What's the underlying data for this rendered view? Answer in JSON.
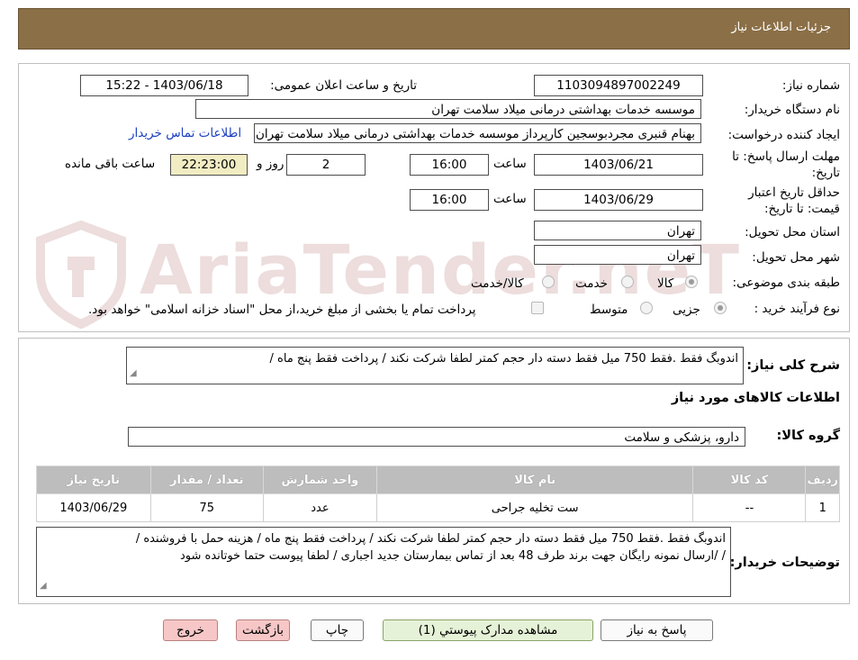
{
  "header": {
    "title": "جزئیات اطلاعات نیاز"
  },
  "info": {
    "need_number_label": "شماره نیاز:",
    "need_number": "1103094897002249",
    "announce_label": "تاریخ و ساعت اعلان عمومی:",
    "announce_value": "1403/06/18 - 15:22",
    "buyer_org_label": "نام دستگاه خریدار:",
    "buyer_org": "موسسه خدمات بهداشتی درمانی میلاد سلامت تهران",
    "creator_label": "ایجاد کننده درخواست:",
    "creator": "بهنام قنبری مجردبوسجین کارپرداز موسسه خدمات بهداشتی درمانی میلاد سلامت تهران",
    "contact_link": "اطلاعات تماس خریدار",
    "deadline_label_1": "مهلت ارسال پاسخ: تا",
    "deadline_label_2": "تاریخ:",
    "deadline_date": "1403/06/21",
    "time_label": "ساعت",
    "deadline_time": "16:00",
    "days_value": "2",
    "days_label": "روز و",
    "remaining_time": "22:23:00",
    "remaining_label": "ساعت باقی مانده",
    "validity_label_1": "حداقل تاریخ اعتبار",
    "validity_label_2": "قیمت: تا تاریخ:",
    "validity_date": "1403/06/29",
    "validity_time": "16:00",
    "province_label": "استان محل تحویل:",
    "province": "تهران",
    "city_label": "شهر محل تحویل:",
    "city": "تهران",
    "category_label": "طبقه بندی موضوعی:",
    "category_options": [
      "کالا",
      "خدمت",
      "کالا/خدمت"
    ],
    "purchase_type_label": "نوع فرآیند خرید :",
    "purchase_options": [
      "جزیی",
      "متوسط"
    ],
    "payment_note": "پرداخت تمام یا بخشی از مبلغ خرید،از محل \"اسناد خزانه اسلامی\" خواهد بود."
  },
  "summary": {
    "label": "شرح کلی نیاز:",
    "text": "اندوبگ فقط .فقط   750 میل فقط دسته دار حجم کمتر لطفا شرکت نکند  /  پرداخت فقط پنج ماه   /"
  },
  "goods": {
    "section_title": "اطلاعات کالاهای مورد نیاز",
    "group_label": "گروه کالا:",
    "group_value": "دارو، پزشکی و سلامت",
    "columns": [
      "ردیف",
      "کد کالا",
      "نام کالا",
      "واحد شمارش",
      "تعداد / مقدار",
      "تاریخ نیاز"
    ],
    "rows": [
      [
        "1",
        "--",
        "ست تخلیه جراحی",
        "عدد",
        "75",
        "1403/06/29"
      ]
    ]
  },
  "buyer_notes": {
    "label": "توضیحات خریدار:",
    "line1": "اندوبگ فقط .فقط   750 میل فقط دسته دار حجم کمتر لطفا شرکت نکند  /  پرداخت فقط پنج ماه   /  هزینه حمل با فروشنده /",
    "line2": "/  /ارسال   نمونه رایگان جهت برند طرف 48 بعد از تماس بیمارستان جدید اجباری / لطفا پیوست حتما خوتانده شود"
  },
  "buttons": {
    "reply": "پاسخ به نیاز",
    "attachments": "مشاهده مدارک پیوستي (1)",
    "print": "چاپ",
    "back": "بازگشت",
    "exit": "خروج"
  },
  "watermark": {
    "text": "AriaTender.neT"
  }
}
